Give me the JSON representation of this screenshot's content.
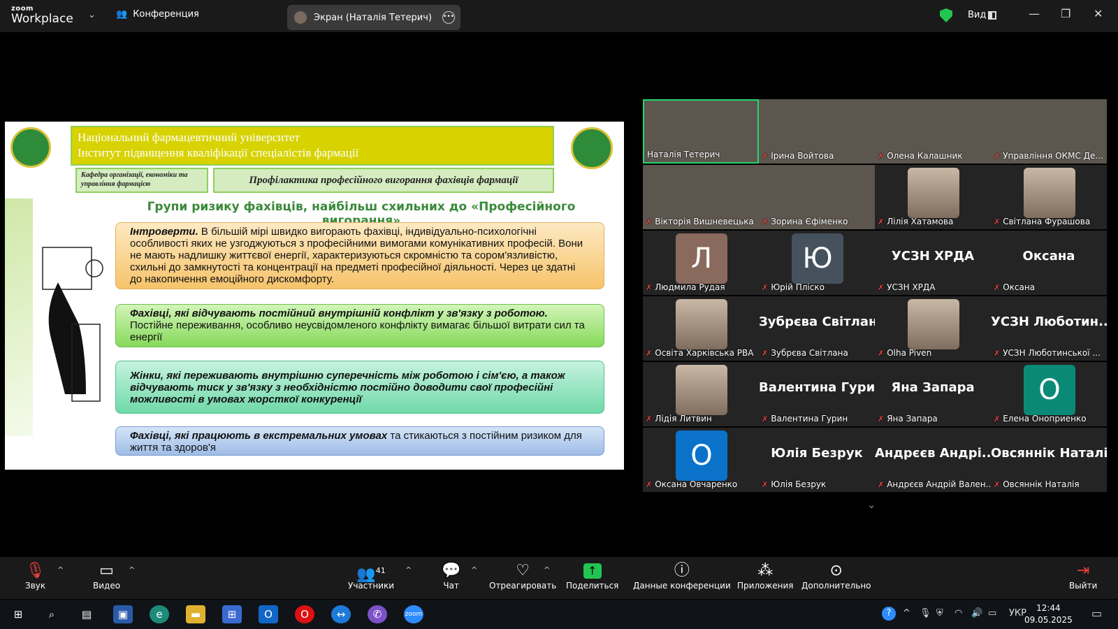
{
  "topbar": {
    "logo_small": "zoom",
    "logo_big": "Workplace",
    "meeting_label": "Конференция",
    "share_label": "Экран (Наталія Тетерич)",
    "view_label": "Вид"
  },
  "slide": {
    "university": "Національний фармацевтичний університет",
    "institute": "Інститут підвищення кваліфікації спеціалістів фармації",
    "department": "Кафедра організації, економіки та управління фармацією",
    "title": "Профілактика професійного вигорання фахівців фармації",
    "heading": "Групи ризику фахівців, найбільш схильних до «Професійного вигорання»",
    "box1_lead": "Інтроверти.",
    "box1_text": " В більшій мірі швидко вигорають фахівці, індивідуально-психологічні особливості яких не узгоджуються з професійними вимогами комунікативних професій. Вони не мають надлишку життєвої енергії, характеризуються скромністю та сором'язливістю, схильні до замкнутості та концентрації на предметі професійної діяльності. Через це здатні до накопичення емоційного дискомфорту.",
    "box2_lead": "Фахівці, які відчувають постійний внутрішній конфлікт у зв'язку з роботою.",
    "box2_text": " Постійне переживання, особливо неусвідомленого конфлікту вимагає більшої витрати сил та енергії",
    "box3_lead": "Жінки, які переживають внутрішню суперечність між роботою і сім'єю, а також відчувають тиск у зв'язку з необхідністю постійно доводити свої професійні можливості  в умовах жорсткої конкуренції",
    "box4_lead": "Фахівці, які працюють в екстремальних умовах",
    "box4_text": " та стикаються з постійним ризиком для життя та здоров'я"
  },
  "participants": [
    {
      "name": "Наталія Тетерич",
      "type": "video",
      "muted": false
    },
    {
      "name": "Ірина Войтова",
      "type": "video",
      "muted": true
    },
    {
      "name": "Олена Калашник",
      "type": "video",
      "muted": true
    },
    {
      "name": "Управління ОКМС Де...",
      "type": "video",
      "muted": true
    },
    {
      "name": "Вікторія Вишневецька",
      "type": "video",
      "muted": true
    },
    {
      "name": "Зорина  Єфіменко",
      "type": "video",
      "muted": true
    },
    {
      "name": "Лілія Хатамова",
      "type": "photo",
      "muted": true
    },
    {
      "name": "Світлана Фурашова",
      "type": "photo",
      "muted": true
    },
    {
      "name": "Людмила Рудая",
      "type": "avatar",
      "letter": "Л",
      "color": "#8a6a5c",
      "muted": true
    },
    {
      "name": "Юрій Пліско",
      "type": "avatar",
      "letter": "Ю",
      "color": "#45525e",
      "muted": true
    },
    {
      "name": "УСЗН ХРДА",
      "type": "text",
      "big": "УСЗН ХРДА",
      "muted": true
    },
    {
      "name": "Оксана",
      "type": "text",
      "big": "Оксана",
      "muted": true
    },
    {
      "name": "Освіта Харківська РВА",
      "type": "photo",
      "muted": true
    },
    {
      "name": "Зубрєва Світлана",
      "type": "text",
      "big": "Зубрєва Світлана",
      "muted": true
    },
    {
      "name": "Olha Piven",
      "type": "photo",
      "muted": true
    },
    {
      "name": "УСЗН Люботинської ...",
      "type": "text",
      "big": "УСЗН Люботин...",
      "muted": true
    },
    {
      "name": "Лідія Литвин",
      "type": "photo",
      "muted": true
    },
    {
      "name": "Валентина Гурин",
      "type": "text",
      "big": "Валентина Гурин",
      "muted": true
    },
    {
      "name": "Яна Запара",
      "type": "text",
      "big": "Яна Запара",
      "muted": true
    },
    {
      "name": "Елена Оноприенко",
      "type": "avatar",
      "letter": "О",
      "color": "#0a8a76",
      "muted": true
    },
    {
      "name": "Оксана Овчаренко",
      "type": "avatar",
      "letter": "О",
      "color": "#0b72c9",
      "muted": true
    },
    {
      "name": "Юлія Безрук",
      "type": "text",
      "big": "Юлія Безрук",
      "muted": true
    },
    {
      "name": "Андрєєв Андрій Вален...",
      "type": "text",
      "big": "Андрєєв Андрі...",
      "muted": true
    },
    {
      "name": "Овсяннік Наталія",
      "type": "text",
      "big": "Овсяннік Наталія",
      "muted": true
    }
  ],
  "toolbar": {
    "audio": "Звук",
    "video": "Видео",
    "participants": "Участники",
    "participants_count": "41",
    "chat": "Чат",
    "react": "Отреагировать",
    "share": "Поделиться",
    "info": "Данные конференции",
    "apps": "Приложения",
    "more": "Дополнительно",
    "leave": "Выйти"
  },
  "taskbar": {
    "lang": "УКР",
    "time": "12:44",
    "date": "09.05.2025"
  },
  "colors": {
    "accent_green": "#23c552",
    "muted_red": "#e8413b",
    "active_border": "#23d96b"
  }
}
